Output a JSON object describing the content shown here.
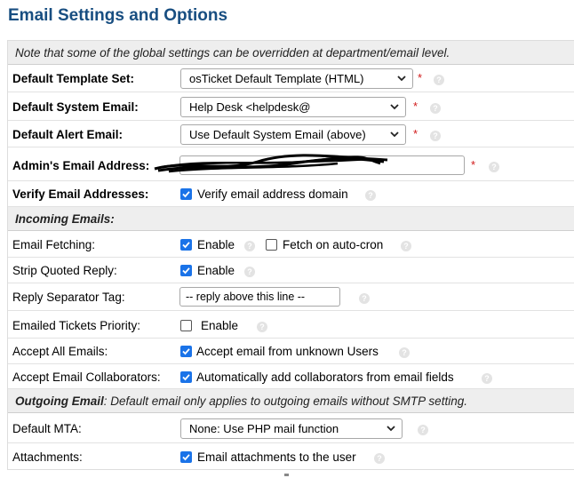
{
  "page": {
    "title": "Email Settings and Options"
  },
  "notes": {
    "global_note": "Note that some of the global settings can be overridden at department/email level."
  },
  "fields": {
    "template_set": {
      "label": "Default Template Set:",
      "value": "osTicket Default Template (HTML)"
    },
    "system_email": {
      "label": "Default System Email:",
      "value": "Help Desk <helpdesk@"
    },
    "alert_email": {
      "label": "Default Alert Email:",
      "value": "Use Default System Email (above)"
    },
    "admin_email": {
      "label": "Admin's Email Address:",
      "value": ""
    },
    "verify_email": {
      "label": "Verify Email Addresses:",
      "checkbox_label": "Verify email address domain",
      "checked": true
    }
  },
  "incoming": {
    "header": "Incoming Emails:",
    "fetching": {
      "label": "Email Fetching:",
      "enable_label": "Enable",
      "enable_checked": true,
      "cron_label": "Fetch on auto-cron",
      "cron_checked": false
    },
    "strip_quoted": {
      "label": "Strip Quoted Reply:",
      "enable_label": "Enable",
      "checked": true
    },
    "reply_separator": {
      "label": "Reply Separator Tag:",
      "value": "-- reply above this line --"
    },
    "ticket_priority": {
      "label": "Emailed Tickets Priority:",
      "enable_label": "Enable",
      "checked": false
    },
    "accept_all": {
      "label": "Accept All Emails:",
      "checkbox_label": "Accept email from unknown Users",
      "checked": true
    },
    "accept_collab": {
      "label": "Accept Email Collaborators:",
      "checkbox_label": "Automatically add collaborators from email fields",
      "checked": true
    }
  },
  "outgoing": {
    "header_bold": "Outgoing Email",
    "header_rest": ": Default email only applies to outgoing emails without SMTP setting.",
    "mta": {
      "label": "Default MTA:",
      "value": "None: Use PHP mail function"
    },
    "attachments": {
      "label": "Attachments:",
      "checkbox_label": "Email attachments to the user",
      "checked": true
    }
  },
  "glyphs": {
    "required": "*",
    "help": "?"
  },
  "colors": {
    "title": "#184e81",
    "required": "#d11a1a",
    "checkbox": "#1a73e8",
    "header_bg": "#eeeeee"
  },
  "icons": {
    "help": "help-icon",
    "dropdown": "chevron-down-icon",
    "check": "check-icon"
  }
}
